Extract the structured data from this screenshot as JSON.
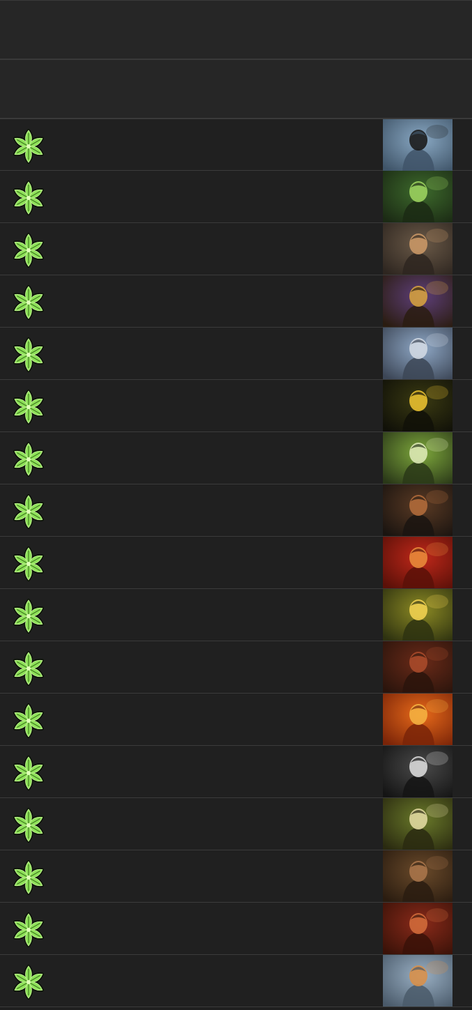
{
  "header_rows": [
    {},
    {}
  ],
  "rows": [
    {
      "talent_icon": "green-star-talent-icon",
      "portrait": "naga-serpent-portrait",
      "palette": [
        "#8aa9c4",
        "#3f5468",
        "#1c1c1c"
      ]
    },
    {
      "talent_icon": "green-star-talent-icon",
      "portrait": "forest-stag-portrait",
      "palette": [
        "#3d6a2c",
        "#1b2a14",
        "#9bd25e"
      ]
    },
    {
      "talent_icon": "green-star-talent-icon",
      "portrait": "bearded-warrior-portrait",
      "palette": [
        "#6b5a48",
        "#2e2620",
        "#c99766"
      ]
    },
    {
      "talent_icon": "green-star-talent-icon",
      "portrait": "armored-priestess-portrait",
      "palette": [
        "#5e3f7a",
        "#2a1c10",
        "#d4a040"
      ]
    },
    {
      "talent_icon": "green-star-talent-icon",
      "portrait": "dwarf-swordsman-portrait",
      "palette": [
        "#8fa8c6",
        "#3c4656",
        "#d0d8e2"
      ]
    },
    {
      "talent_icon": "green-star-talent-icon",
      "portrait": "golden-bird-portrait",
      "palette": [
        "#3a3a12",
        "#101008",
        "#e8c030"
      ]
    },
    {
      "talent_icon": "green-star-talent-icon",
      "portrait": "hooded-archer-stag-portrait",
      "palette": [
        "#7ea83c",
        "#2a3818",
        "#dce8b4"
      ]
    },
    {
      "talent_icon": "green-star-talent-icon",
      "portrait": "axe-berserker-portrait",
      "palette": [
        "#5a3a24",
        "#1a1410",
        "#b06a3a"
      ]
    },
    {
      "talent_icon": "green-star-talent-icon",
      "portrait": "red-beast-rider-portrait",
      "palette": [
        "#c0281a",
        "#5a1008",
        "#e88a3a"
      ]
    },
    {
      "talent_icon": "green-star-talent-icon",
      "portrait": "horned-druid-portrait",
      "palette": [
        "#8c8a24",
        "#2e3210",
        "#f0d050"
      ]
    },
    {
      "talent_icon": "green-star-talent-icon",
      "portrait": "tauren-brute-portrait",
      "palette": [
        "#6a2a18",
        "#2a140c",
        "#a84a2a"
      ]
    },
    {
      "talent_icon": "green-star-talent-icon",
      "portrait": "sunset-wanderer-portrait",
      "palette": [
        "#e86a1a",
        "#7a2408",
        "#f4b040"
      ]
    },
    {
      "talent_icon": "green-star-talent-icon",
      "portrait": "skull-masked-beast-portrait",
      "palette": [
        "#4a4a4a",
        "#141414",
        "#d8d8d8"
      ]
    },
    {
      "talent_icon": "green-star-talent-icon",
      "portrait": "green-haired-nymph-portrait",
      "palette": [
        "#6a7a2a",
        "#2a2a10",
        "#e0d8a0"
      ]
    },
    {
      "talent_icon": "green-star-talent-icon",
      "portrait": "brown-bear-portrait",
      "palette": [
        "#6a4a2a",
        "#2a1c10",
        "#a8744a"
      ]
    },
    {
      "talent_icon": "green-star-talent-icon",
      "portrait": "red-bearded-dwarf-portrait",
      "palette": [
        "#8a2a1a",
        "#3a1208",
        "#d06a3a"
      ]
    },
    {
      "talent_icon": "green-star-talent-icon",
      "portrait": "antlered-helm-viking-portrait",
      "palette": [
        "#9ab0c4",
        "#4a5a6a",
        "#d8904a"
      ]
    }
  ]
}
